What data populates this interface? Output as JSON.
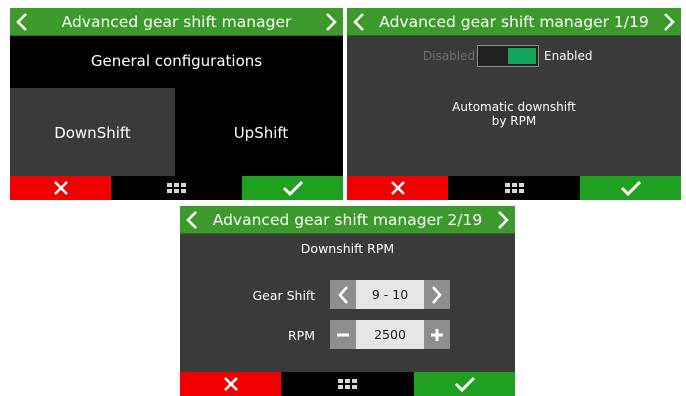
{
  "screen1": {
    "title": "Advanced gear shift manager",
    "general_label": "General configurations",
    "downshift_label": "DownShift",
    "upshift_label": "UpShift"
  },
  "screen2": {
    "title": "Advanced gear shift manager 1/19",
    "disabled_label": "Disabled",
    "enabled_label": "Enabled",
    "toggle_state": "enabled",
    "description_line1": "Automatic downshift",
    "description_line2": "by RPM"
  },
  "screen3": {
    "title": "Advanced gear shift manager 2/19",
    "subtitle": "Downshift RPM",
    "gear_shift_label": "Gear Shift",
    "gear_shift_value": "9 - 10",
    "rpm_label": "RPM",
    "rpm_value": "2500"
  },
  "colors": {
    "title_bar": "#3b9a2b",
    "cancel": "#f00000",
    "ok": "#20a020",
    "toggle_on": "#13a65b",
    "panel": "#3a3a3a"
  },
  "icons": {
    "prev": "chevron-left-icon",
    "next": "chevron-right-icon",
    "cancel": "close-icon",
    "menu": "grid-icon",
    "ok": "check-icon",
    "decrement": "minus-icon",
    "increment": "plus-icon"
  }
}
